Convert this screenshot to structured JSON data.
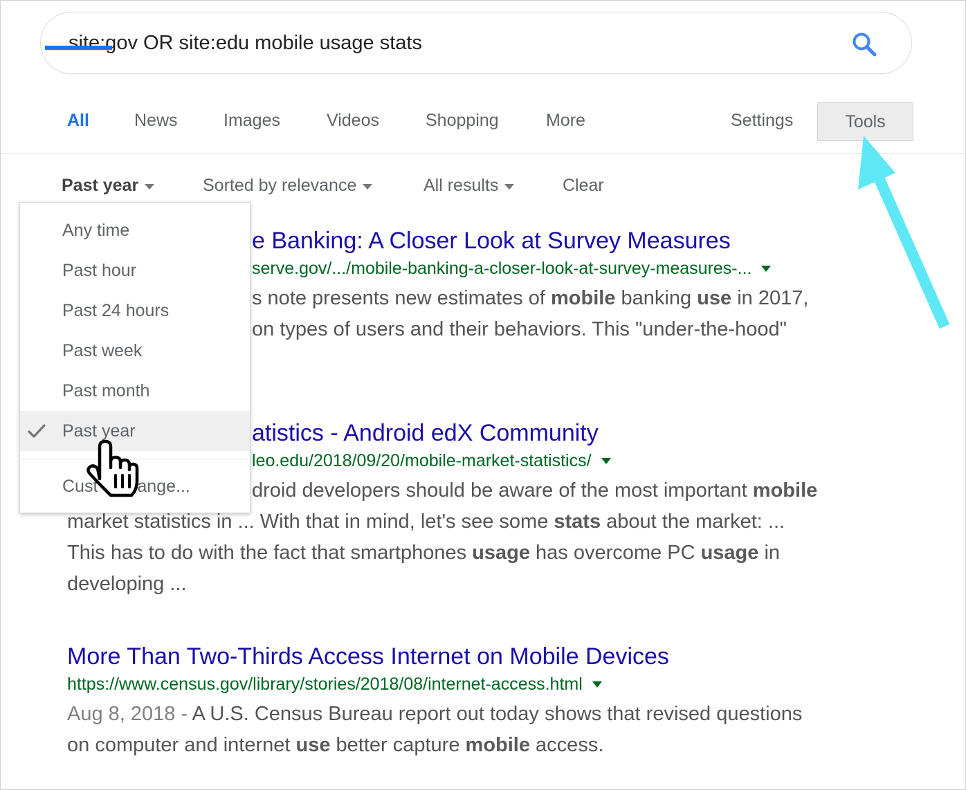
{
  "search": {
    "query": "site:gov OR site:edu mobile usage stats",
    "icon": "magnifier-icon",
    "accent_color": "#4285f4"
  },
  "tabs": [
    {
      "label": "All",
      "active": true
    },
    {
      "label": "News"
    },
    {
      "label": "Images"
    },
    {
      "label": "Videos"
    },
    {
      "label": "Shopping"
    },
    {
      "label": "More"
    }
  ],
  "settings_label": "Settings",
  "tools_label": "Tools",
  "filters": {
    "time": "Past year",
    "sort": "Sorted by relevance",
    "results": "All results",
    "clear": "Clear"
  },
  "time_menu": {
    "items": [
      "Any time",
      "Past hour",
      "Past 24 hours",
      "Past week",
      "Past month",
      "Past year",
      "Custom range..."
    ],
    "selected": "Past year",
    "custom_visible": [
      "Cust",
      "ange..."
    ]
  },
  "results": [
    {
      "title": "e Banking: A Closer Look at Survey Measures",
      "url": "serve.gov/.../mobile-banking-a-closer-look-at-survey-measures-...",
      "snippet_lines": [
        [
          "s note presents new estimates of ",
          {
            "b": "mobile"
          },
          " banking ",
          {
            "b": "use"
          },
          " in 2017,"
        ],
        [
          "on types of users and their behaviors. This \"under-the-hood\""
        ]
      ]
    },
    {
      "title": "atistics - Android edX Community",
      "url": "leo.edu/2018/09/20/mobile-market-statistics/",
      "snippet_lines": [
        [
          "droid developers should be aware of the most important ",
          {
            "b": "mobile"
          }
        ],
        [
          "market statistics in ... With that in mind, let's see some ",
          {
            "b": "stats"
          },
          " about the market: ..."
        ],
        [
          "This has to do with the fact that smartphones ",
          {
            "b": "usage"
          },
          " has overcome PC ",
          {
            "b": "usage"
          },
          " in"
        ],
        [
          "developing ..."
        ]
      ]
    },
    {
      "title": "More Than Two-Thirds Access Internet on Mobile Devices",
      "url": "https://www.census.gov/library/stories/2018/08/internet-access.html",
      "date": "Aug 8, 2018 - ",
      "snippet_lines": [
        [
          "A U.S. Census Bureau report out today shows that revised questions"
        ],
        [
          "on computer and internet ",
          {
            "b": "use"
          },
          " better capture ",
          {
            "b": "mobile"
          },
          " access."
        ]
      ]
    }
  ],
  "colors": {
    "link": "#1a0dab",
    "url": "#006621",
    "annotation_arrow": "#5ee8f5"
  }
}
